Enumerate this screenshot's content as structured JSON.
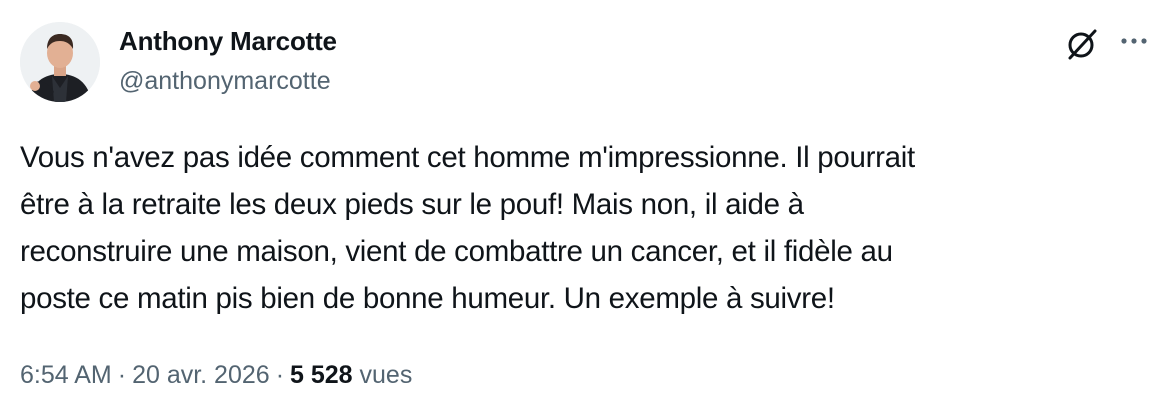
{
  "author": {
    "display_name": "Anthony Marcotte",
    "handle": "@anthonymarcotte"
  },
  "actions": {
    "grok_icon": "grok-icon",
    "more_icon": "more-icon"
  },
  "tweet": {
    "lines": [
      "Vous n'avez pas idée comment cet homme m'impressionne. Il pourrait",
      "être à la retraite les deux pieds sur le pouf! Mais non, il aide à",
      "reconstruire une maison, vient de combattre un cancer, et il fidèle au",
      "poste ce matin pis bien de bonne humeur. Un exemple à suivre!"
    ]
  },
  "meta": {
    "time": "6:54 AM",
    "separator": "·",
    "date": "20 avr. 2026",
    "views_count": "5 528",
    "views_label": "vues"
  },
  "colors": {
    "text": "#0f1419",
    "secondary": "#536471",
    "background": "#ffffff"
  }
}
